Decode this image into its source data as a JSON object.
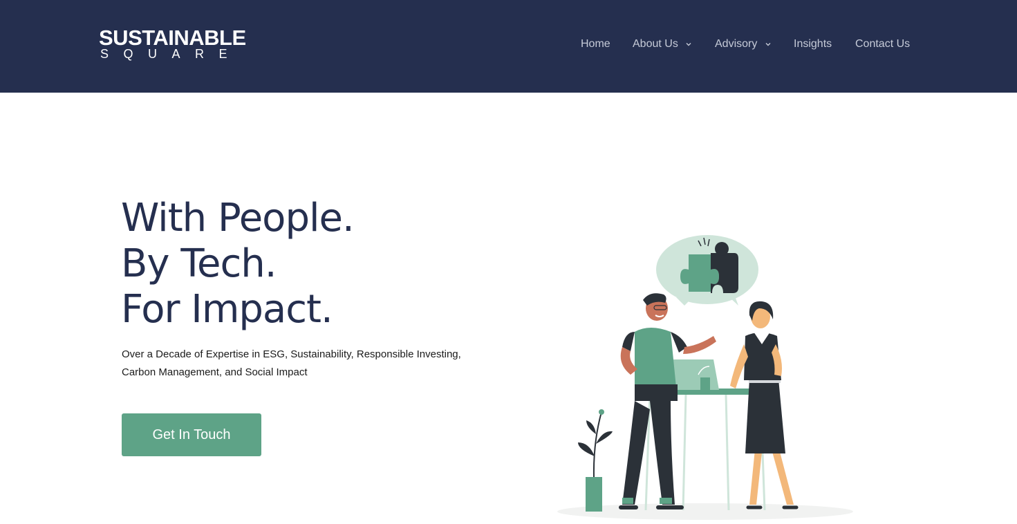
{
  "header": {
    "logo": {
      "line1": "SUSTAINABLE",
      "line2": "SQUARE"
    },
    "nav": [
      {
        "label": "Home",
        "has_dropdown": false
      },
      {
        "label": "About Us",
        "has_dropdown": true,
        "icon": "chevron-down-icon"
      },
      {
        "label": "Advisory",
        "has_dropdown": true,
        "icon": "chevron-down-icon"
      },
      {
        "label": "Insights",
        "has_dropdown": false
      },
      {
        "label": "Contact Us",
        "has_dropdown": false
      }
    ]
  },
  "hero": {
    "title_lines": [
      "With People.",
      "By Tech.",
      "For Impact."
    ],
    "subtitle": "Over a Decade of Expertise in ESG, Sustainability, Responsible Investing, Carbon Management, and Social Impact",
    "cta_label": "Get In Touch"
  },
  "colors": {
    "header_bg": "#252f4f",
    "title": "#252f4f",
    "accent": "#5ea387",
    "nav_text": "#c6cbd8"
  }
}
